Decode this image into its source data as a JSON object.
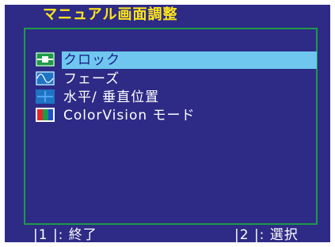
{
  "screen": {
    "title": "マニュアル画面調整"
  },
  "menu": {
    "items": [
      {
        "label": "クロック",
        "icon": "clock-icon",
        "selected": true
      },
      {
        "label": "フェーズ",
        "icon": "phase-icon",
        "selected": false
      },
      {
        "label": "水平/ 垂直位置",
        "icon": "position-icon",
        "selected": false
      },
      {
        "label": "ColorVision  モード",
        "icon": "colorvision-icon",
        "selected": false
      }
    ]
  },
  "footer": {
    "exit_label": "|1 |:  終了",
    "select_label": "|2 |:  選択"
  },
  "colors": {
    "background": "#2e2b86",
    "title": "#ffe61a",
    "frame": "#1e9a49",
    "highlight": "#6fc7ef",
    "icon_blue": "#1f74c4"
  }
}
